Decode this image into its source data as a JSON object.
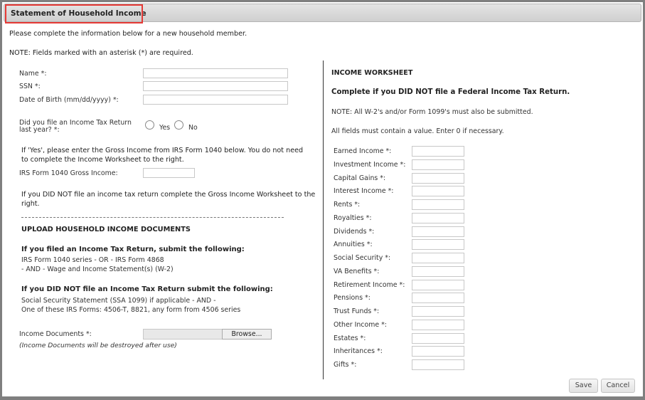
{
  "dialog": {
    "title": "Statement of Household Income",
    "intro": "Please complete the information below for a new household member.",
    "note": "NOTE: Fields marked with an asterisk (*) are required."
  },
  "personal": {
    "name_label": "Name *:",
    "name_value": "",
    "ssn_label": "SSN *:",
    "ssn_value": "",
    "dob_label": "Date of Birth (mm/dd/yyyy) *:",
    "dob_value": "",
    "tax_return_label_line1": "Did you file an Income Tax Return",
    "tax_return_label_line2": "last year? *:",
    "tax_return_options": [
      {
        "label": "Yes",
        "checked": false
      },
      {
        "label": "No",
        "checked": false
      }
    ]
  },
  "gross": {
    "if_yes_text": "If 'Yes', please enter the Gross Income from IRS Form 1040 below. You do not need to complete the Income Worksheet to the right.",
    "form1040_label": "IRS Form 1040 Gross Income:",
    "form1040_value": "",
    "if_not_text": "If you DID NOT file an income tax return complete the Gross Income Worksheet to the right."
  },
  "upload": {
    "heading": "UPLOAD HOUSEHOLD INCOME DOCUMENTS",
    "filed_heading": "If you filed an Income Tax Return, submit the following:",
    "filed_line1": "IRS Form 1040 series - OR - IRS Form 4868",
    "filed_line2": "- AND - Wage and Income Statement(s) (W-2)",
    "not_filed_heading": "If you DID NOT file an Income Tax Return submit the following:",
    "not_filed_line1": "Social Security Statement (SSA 1099) if applicable - AND -",
    "not_filed_line2": "One of these IRS Forms: 4506-T, 8821, any form from 4506 series",
    "documents_label": "Income Documents *:",
    "browse_label": "Browse...",
    "destroy_note": "(Income Documents will be destroyed after use)"
  },
  "worksheet": {
    "heading": "INCOME WORKSHEET",
    "subheading": "Complete if you DID NOT file a Federal Income Tax Return.",
    "note": "NOTE: All W-2's and/or Form 1099's must also be submitted.",
    "instruction": "All fields must contain a value. Enter 0 if necessary.",
    "fields": [
      {
        "label": "Earned Income *:",
        "value": ""
      },
      {
        "label": "Investment Income *:",
        "value": ""
      },
      {
        "label": "Capital Gains *:",
        "value": ""
      },
      {
        "label": "Interest Income *:",
        "value": ""
      },
      {
        "label": "Rents *:",
        "value": ""
      },
      {
        "label": "Royalties *:",
        "value": ""
      },
      {
        "label": "Dividends *:",
        "value": ""
      },
      {
        "label": "Annuities *:",
        "value": ""
      },
      {
        "label": "Social Security *:",
        "value": ""
      },
      {
        "label": "VA Benefits *:",
        "value": ""
      },
      {
        "label": "Retirement Income *:",
        "value": ""
      },
      {
        "label": "Pensions *:",
        "value": ""
      },
      {
        "label": "Trust Funds *:",
        "value": ""
      },
      {
        "label": "Other Income *:",
        "value": ""
      },
      {
        "label": "Estates *:",
        "value": ""
      },
      {
        "label": "Inheritances *:",
        "value": ""
      },
      {
        "label": "Gifts *:",
        "value": ""
      }
    ]
  },
  "actions": {
    "save_label": "Save",
    "cancel_label": "Cancel"
  }
}
